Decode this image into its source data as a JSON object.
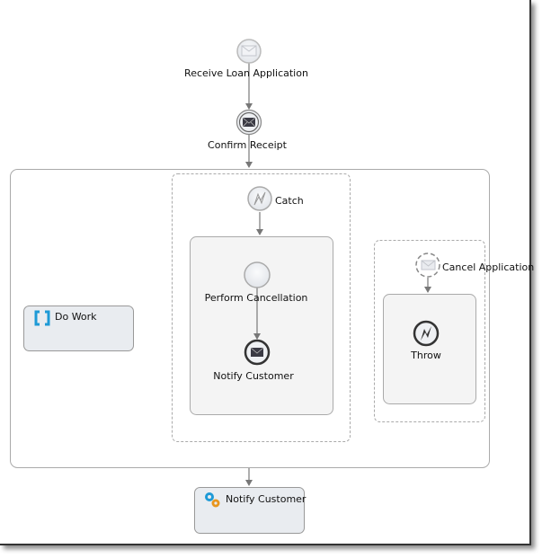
{
  "diagram": {
    "receive_loan": {
      "label": "Receive Loan Application",
      "icon": "envelope-icon"
    },
    "confirm_receipt": {
      "label": "Confirm Receipt",
      "icon": "envelope-filled-icon"
    },
    "do_work": {
      "label": "Do Work",
      "icon": "subprocess-bracket-icon"
    },
    "catch": {
      "label": "Catch",
      "icon": "error-lightning-icon"
    },
    "perform_cancellation": {
      "label": "Perform Cancellation"
    },
    "notify_customer_end": {
      "label": "Notify Customer",
      "icon": "envelope-filled-icon"
    },
    "cancel_application": {
      "label": "Cancel Application",
      "icon": "envelope-icon"
    },
    "throw": {
      "label": "Throw",
      "icon": "error-lightning-icon"
    },
    "notify_customer_task": {
      "label": "Notify Customer",
      "icon": "gears-icon"
    }
  },
  "colors": {
    "task_fill": "#e9ecf0",
    "subprocess_fill": "#f4f4f4",
    "accent_blue": "#1e9ad6",
    "accent_orange": "#e8961e"
  }
}
